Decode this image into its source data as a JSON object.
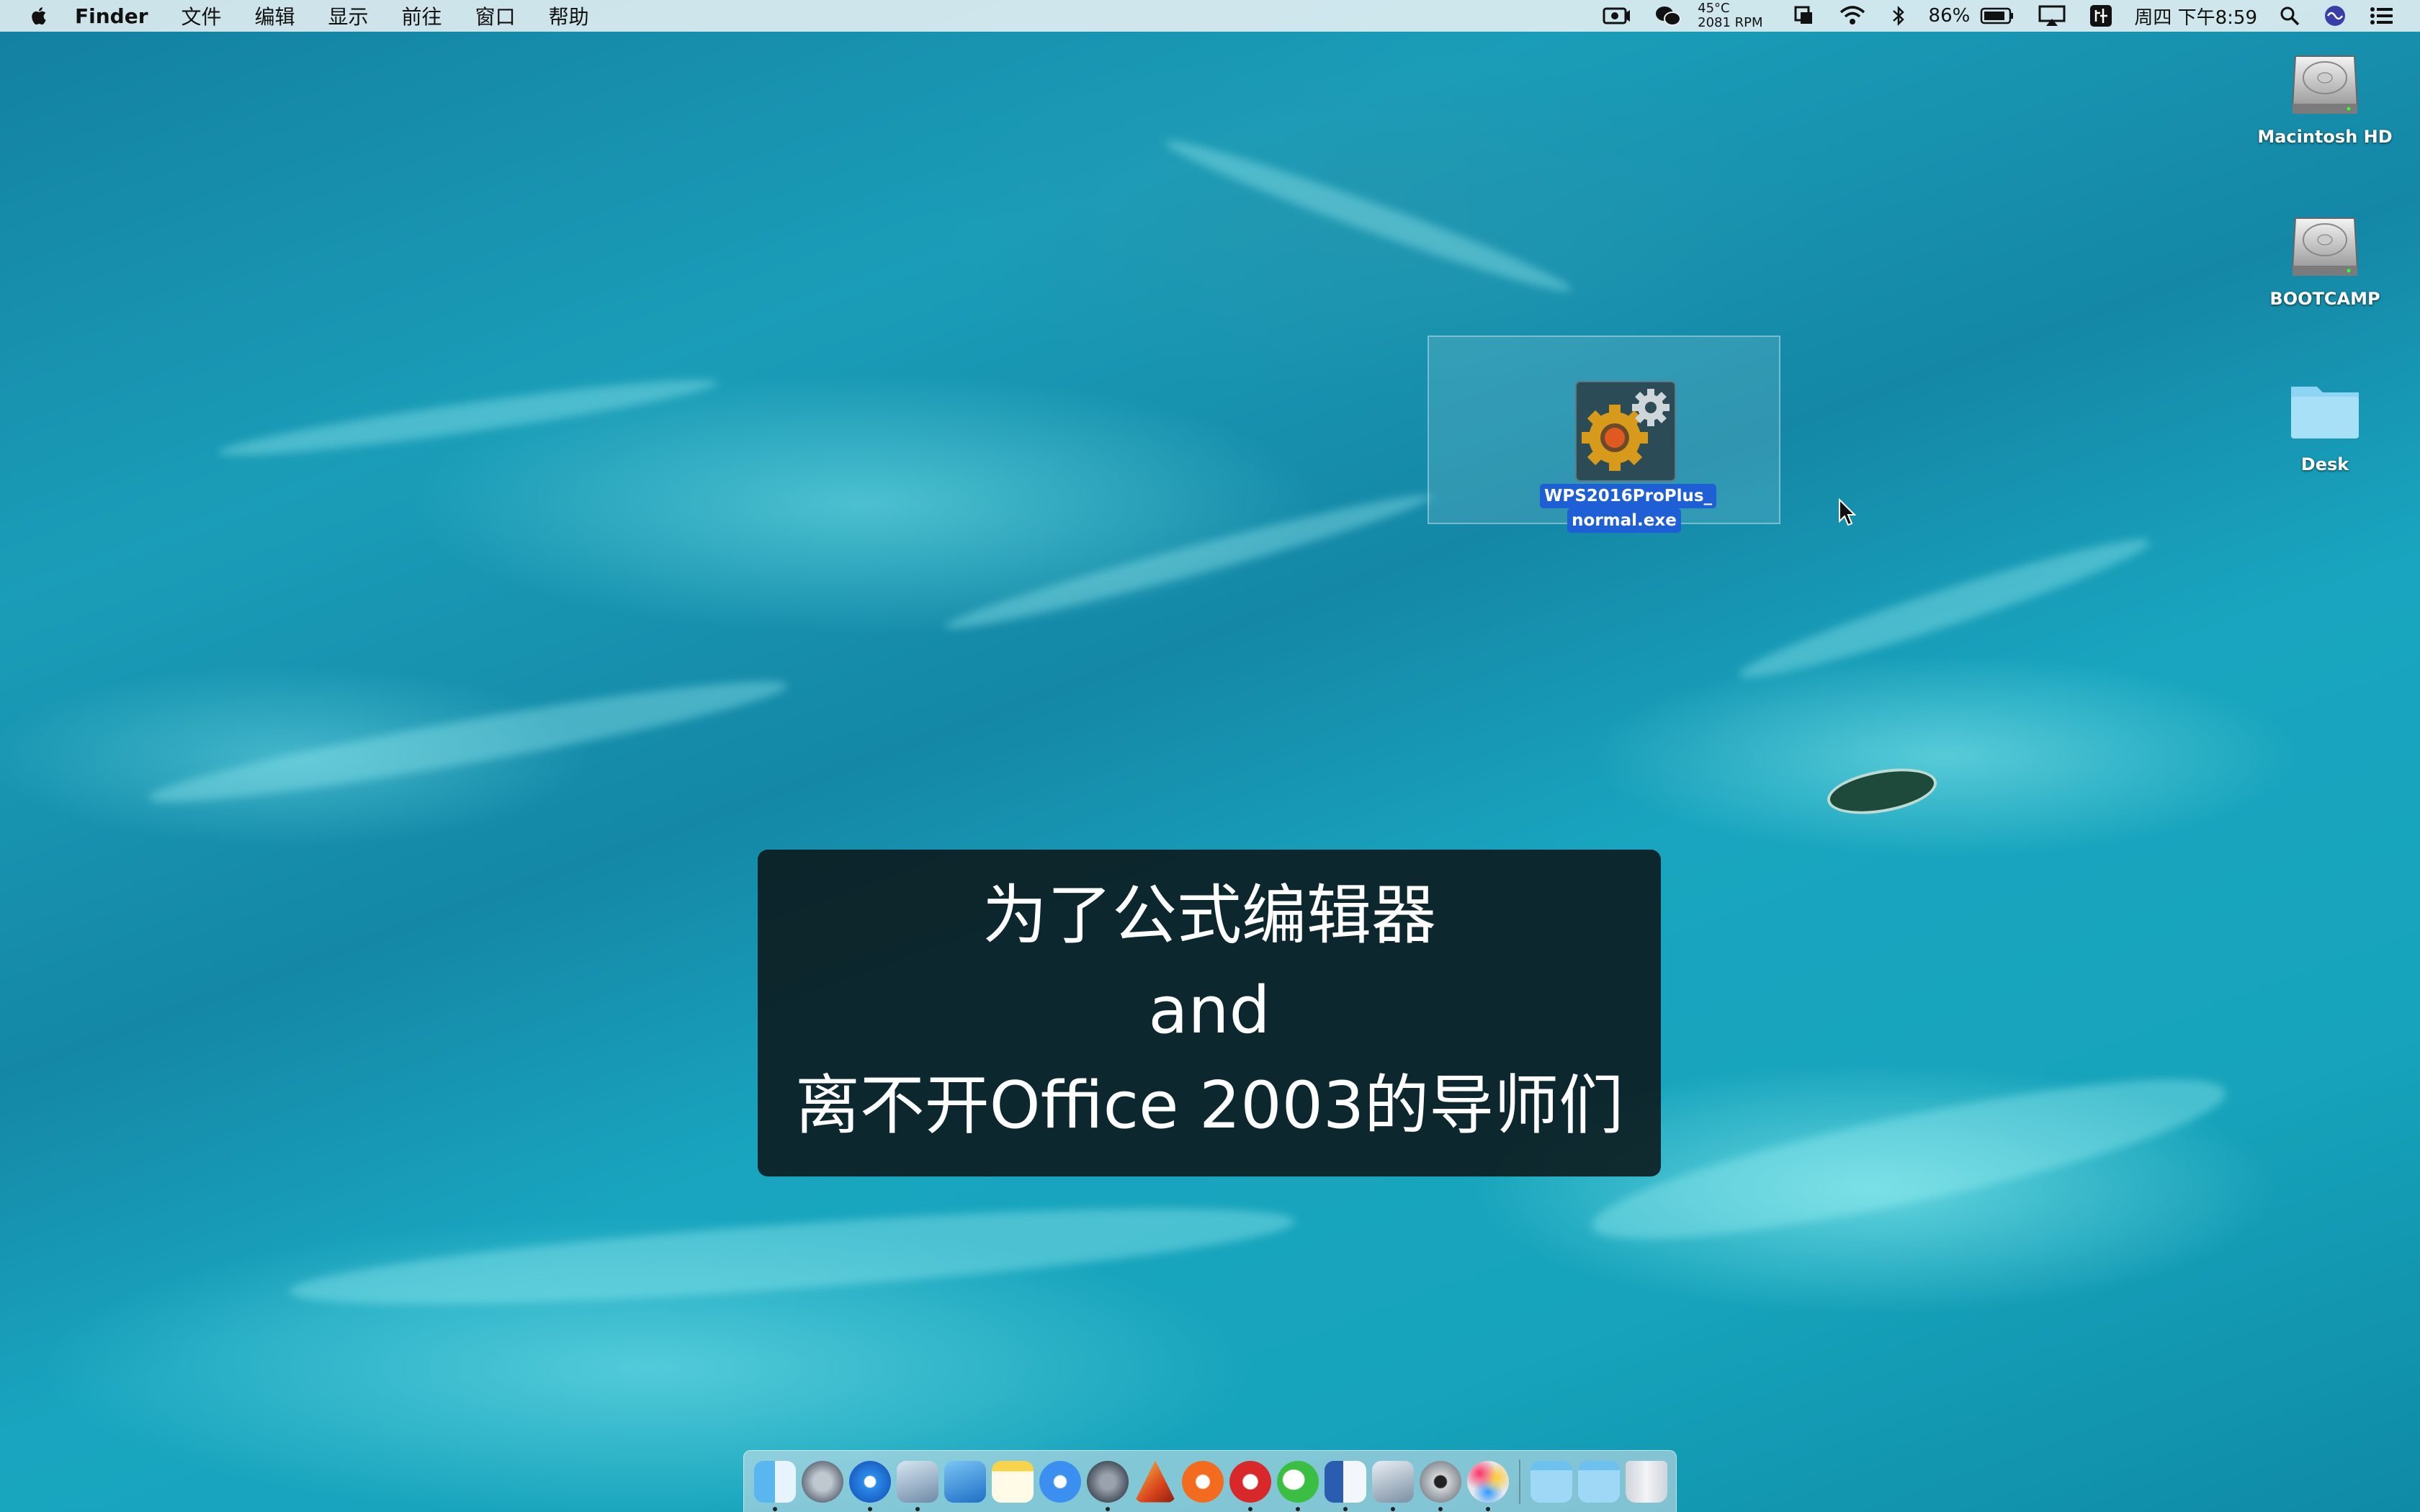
{
  "menubar": {
    "app_name": "Finder",
    "items": [
      "文件",
      "编辑",
      "显示",
      "前往",
      "窗口",
      "帮助"
    ],
    "temperature": "45°C",
    "fan_speed": "2081 RPM",
    "battery": "86%",
    "datetime": "周四 下午8:59"
  },
  "desktop": {
    "icons": [
      {
        "label": "Macintosh HD",
        "icon": "hard-drive-icon"
      },
      {
        "label": "BOOTCAMP",
        "icon": "hard-drive-icon"
      },
      {
        "label": "Desk",
        "icon": "folder-icon"
      }
    ],
    "selected_file": {
      "line1": "WPS2016ProPlus_",
      "line2": "normal.exe",
      "icon": "installer-gear-icon"
    }
  },
  "subtitle": {
    "line1": "为了公式编辑器",
    "line2": "and",
    "line3": "离不开Office 2003的导师们"
  },
  "dock": {
    "apps": [
      "finder",
      "launchpad",
      "safari",
      "preview",
      "xcode",
      "notes",
      "pages",
      "system-preferences",
      "matlab",
      "infuse",
      "netease-music",
      "wechat",
      "word",
      "photo-browser",
      "disk-utility",
      "game-center",
      "downloads-folder",
      "documents-folder",
      "trash"
    ]
  },
  "colors": {
    "selection_blue": "#1f5fd6",
    "subtitle_bg": "#0a1416"
  }
}
